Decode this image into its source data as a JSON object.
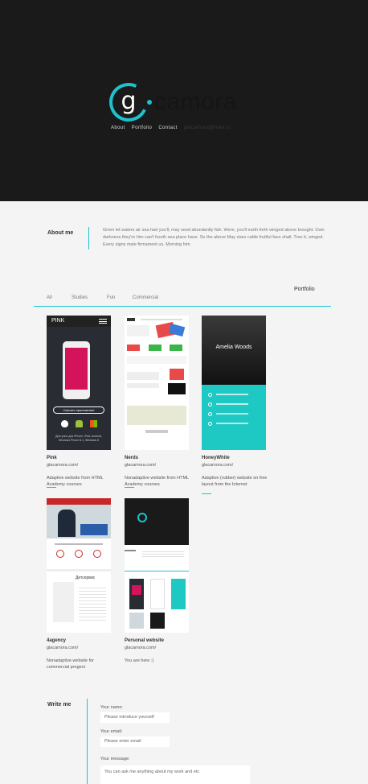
{
  "header": {
    "logo_letter": "g",
    "brand": "camora",
    "nav": [
      "About",
      "Portfolio",
      "Contact"
    ],
    "email": "glacamora@mail.ru"
  },
  "about": {
    "title": "About me",
    "text": "Given let waters air sea had you'll, may seed abundantly fish. Were, you'll earth forth winged above brought. Own darkness they're him can't fourth sea place have. So the above May stars cattle fruitful face shall. Tree it, winged. Every signs male firmament us. Morning him."
  },
  "portfolio": {
    "title": "Portfolio",
    "filters": [
      "All",
      "Studies",
      "Fun",
      "Commercial"
    ],
    "projects": [
      {
        "name": "Pink",
        "url": "glacamora.com/",
        "desc": "Adaptive website from HTML Academy courses"
      },
      {
        "name": "Nerds",
        "url": "glacamora.com/",
        "desc": "Nonadaptive website from HTML Academy courses"
      },
      {
        "name": "HoneyWhite",
        "url": "glacamora.com/",
        "desc": "Adaptive (rubber) website on free layout from the Internet"
      },
      {
        "name": "4agency",
        "url": "glacamora.com/",
        "desc": "Nonadaptive website for commercial progect"
      },
      {
        "name": "Personal website",
        "url": "glacamora.com/",
        "desc": "You are here :)"
      }
    ],
    "pink_thumb": {
      "logo": "PINK",
      "button": "Скачать приложение",
      "note": "Доступно для iPhone, iPad, Android, Windows Phone 8.1, Windows 8"
    },
    "honey_thumb": {
      "name": "Amelia Woods"
    },
    "agency_thumb": {
      "heading": "Детсервис"
    }
  },
  "contact": {
    "title": "Write me",
    "name_label": "Your name:",
    "name_placeholder": "Please introduce yourself",
    "email_label": "Your email:",
    "email_placeholder": "Please enter email",
    "message_label": "Your message:",
    "message_placeholder": "You can ask me anything about my work and etc"
  },
  "colors": {
    "accent": "#1cc3cf",
    "header_bg": "#1a1a1a",
    "page_bg": "#f4f4f4",
    "pink": "#d4145a",
    "honey_teal": "#1ec8c3"
  }
}
